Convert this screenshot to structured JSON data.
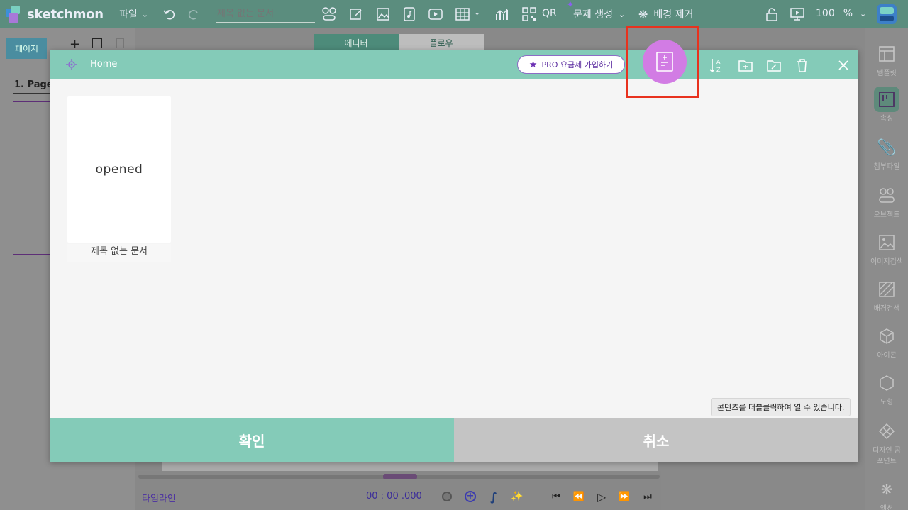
{
  "app": {
    "brand": "sketchmon",
    "menu_file": "파일",
    "doc_title_placeholder": "제목 없는 문서",
    "qr_label": "QR",
    "quiz_label": "문제 생성",
    "bg_remove_label": "배경 제거",
    "zoom_value": "100",
    "zoom_unit": "%"
  },
  "left_panel": {
    "pages_tab": "페이지",
    "page_item": "1.  Page-"
  },
  "editor": {
    "tabs": [
      "에디터",
      "플로우"
    ],
    "timeline_label": "타임라인",
    "timeline_time": "00 : 00 .000"
  },
  "right_sidebar": {
    "items": [
      {
        "label": "템플릿",
        "icon": "template-icon"
      },
      {
        "label": "속성",
        "icon": "properties-icon",
        "active": true
      },
      {
        "label": "첨부파일",
        "icon": "paperclip-icon"
      },
      {
        "label": "오브젝트",
        "icon": "objects-icon"
      },
      {
        "label": "이미지검색",
        "icon": "image-icon"
      },
      {
        "label": "배경검색",
        "icon": "background-icon"
      },
      {
        "label": "아이콘",
        "icon": "cube-icon"
      },
      {
        "label": "도형",
        "icon": "hexagon-icon"
      },
      {
        "label": "디자인 콤포넌트",
        "icon": "component-icon"
      },
      {
        "label": "액션",
        "icon": "action-icon"
      }
    ]
  },
  "modal": {
    "breadcrumb": "Home",
    "pro_button": "PRO 요금제 가입하기",
    "documents": [
      {
        "thumb_text": "opened",
        "name": "제목 없는 문서"
      }
    ],
    "hint": "콘텐츠를 더블클릭하여 열 수 있습니다.",
    "confirm": "확인",
    "cancel": "취소"
  },
  "colors": {
    "topbar": "#5b8d7e",
    "modal_header": "#84cbb8",
    "new_doc_button": "#d27ce4",
    "highlight": "#e8321e",
    "cancel": "#c4c4c4"
  }
}
